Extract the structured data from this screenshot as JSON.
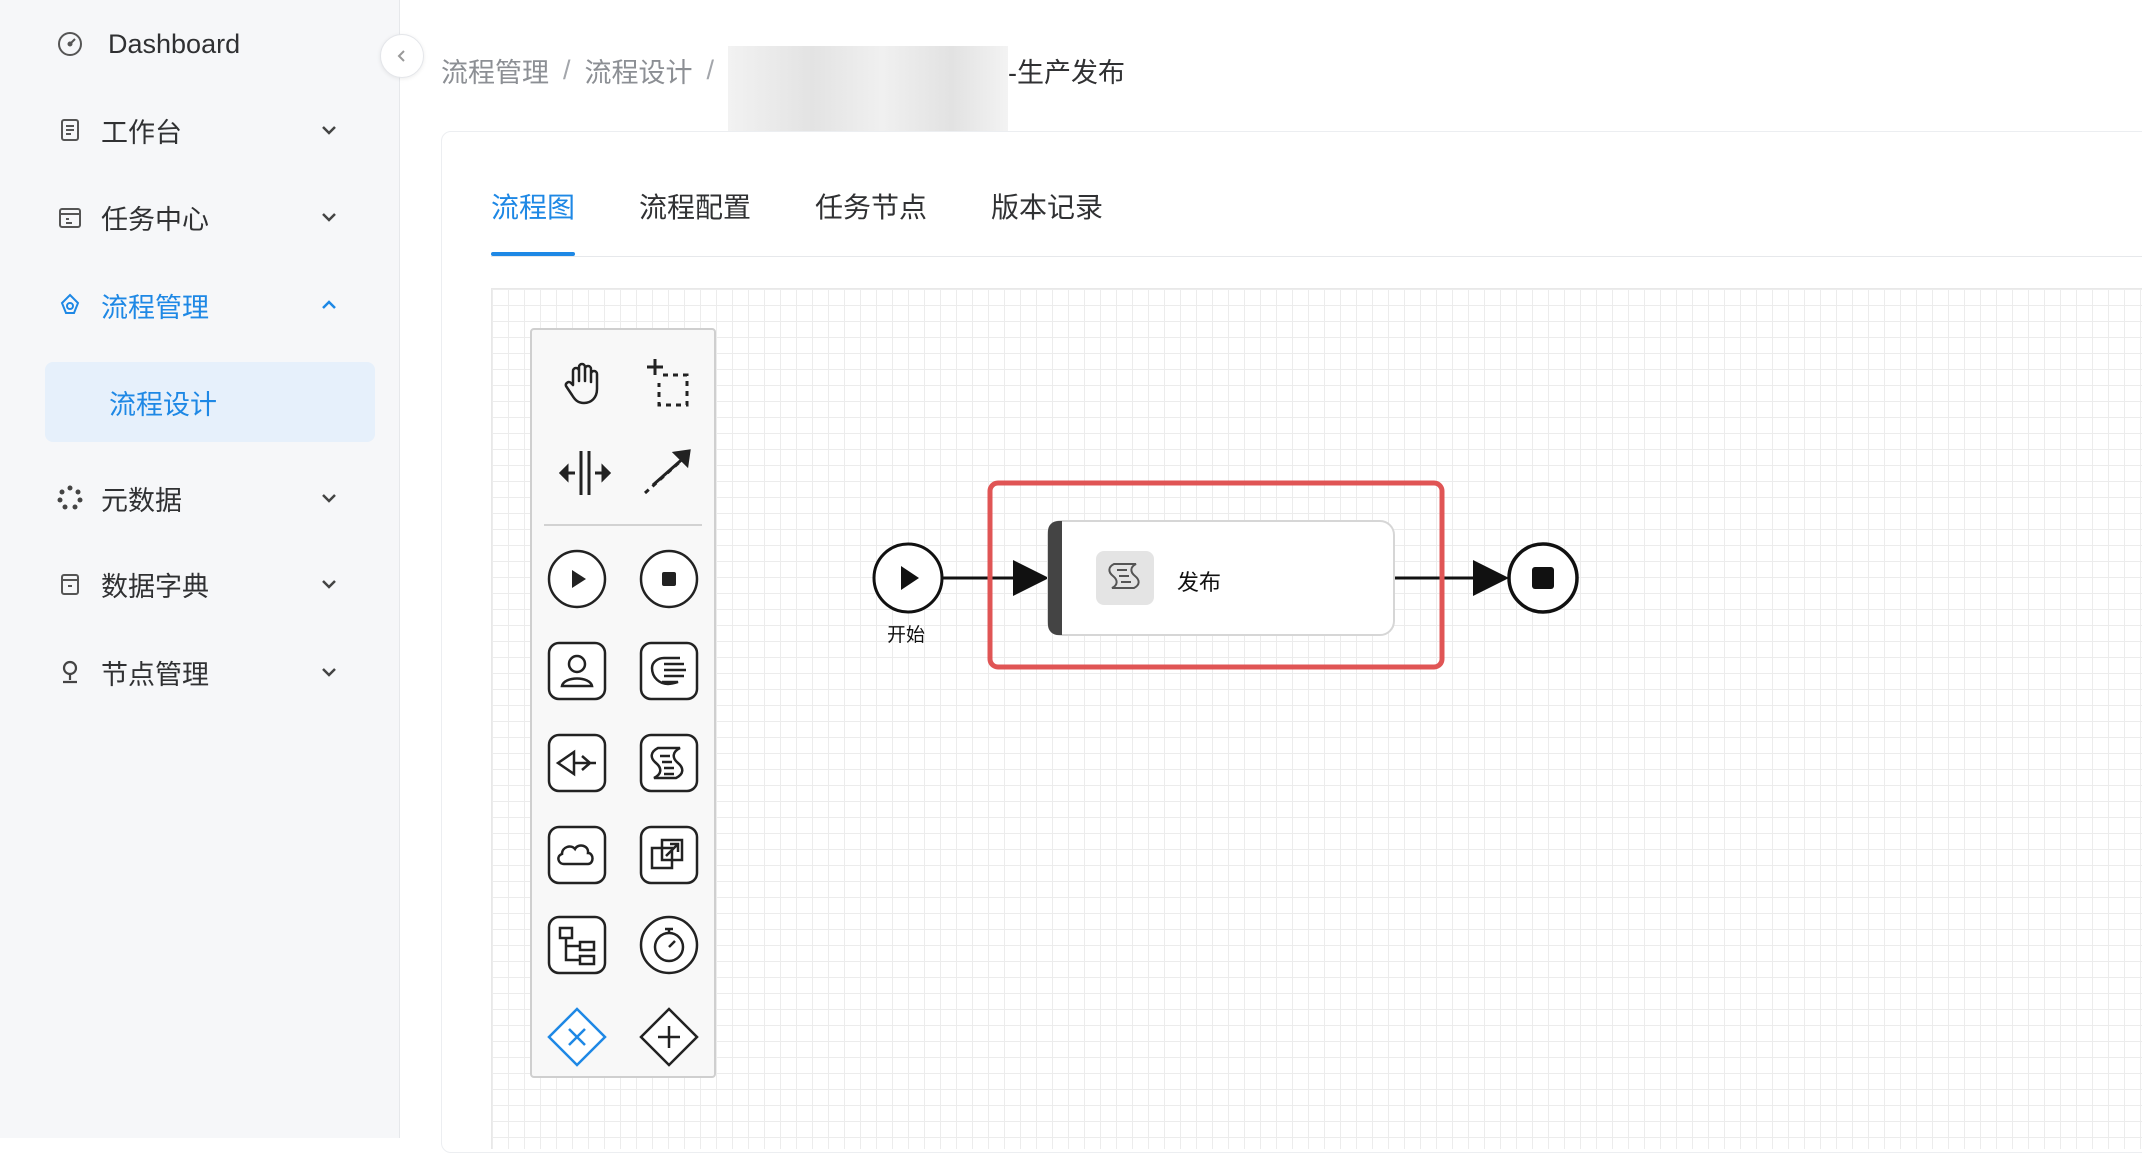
{
  "sidebar": {
    "items": [
      {
        "label": "Dashboard",
        "icon": "speedometer-icon",
        "expandable": false
      },
      {
        "label": "工作台",
        "icon": "document-icon",
        "expandable": true
      },
      {
        "label": "任务中心",
        "icon": "calendar-icon",
        "expandable": true
      },
      {
        "label": "流程管理",
        "icon": "flow-icon",
        "expandable": true,
        "expanded": true,
        "active": true
      },
      {
        "label": "元数据",
        "icon": "loading-circle-icon",
        "expandable": true
      },
      {
        "label": "数据字典",
        "icon": "book-icon",
        "expandable": true
      },
      {
        "label": "节点管理",
        "icon": "map-pin-icon",
        "expandable": true
      }
    ],
    "submenu": {
      "label": "流程设计",
      "active": true
    }
  },
  "breadcrumb": {
    "items": [
      "流程管理",
      "流程设计"
    ],
    "separator": "/",
    "current": "-生产发布"
  },
  "tabs": [
    {
      "label": "流程图",
      "active": true
    },
    {
      "label": "流程配置"
    },
    {
      "label": "任务节点"
    },
    {
      "label": "版本记录"
    }
  ],
  "palette": {
    "tools": [
      "hand-tool-icon",
      "lasso-tool-icon",
      "space-tool-icon",
      "connect-tool-icon"
    ],
    "elements": [
      "start-event-icon",
      "end-event-icon",
      "user-task-icon",
      "manual-task-icon",
      "send-task-icon",
      "script-task-icon",
      "service-task-icon",
      "subprocess-icon",
      "call-activity-icon",
      "timer-event-icon",
      "exclusive-gateway-icon",
      "parallel-gateway-icon"
    ]
  },
  "diagram": {
    "start_label": "开始",
    "task_label": "发布",
    "task_icon": "script-icon",
    "highlight_color": "#e05555"
  },
  "colors": {
    "accent": "#1e88e5",
    "highlight": "#e05555"
  }
}
